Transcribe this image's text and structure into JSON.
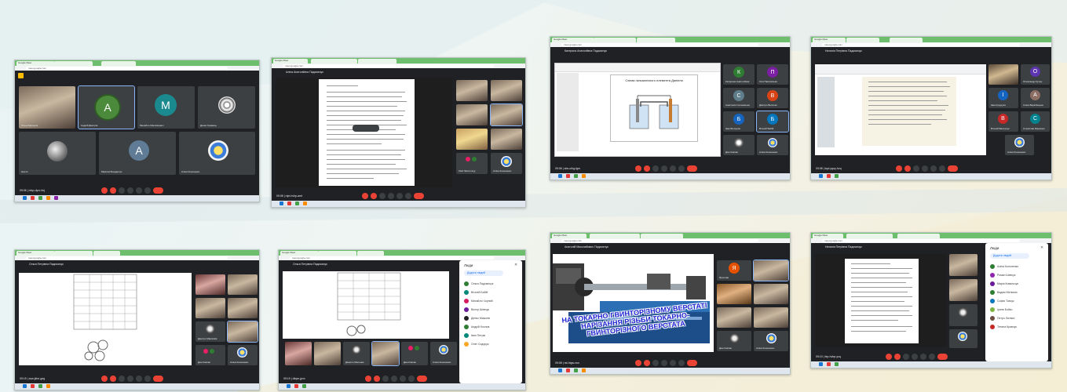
{
  "panels": {
    "p1": {
      "tab1": "Google Meet",
      "url": "meet.google.com",
      "meeting_code": "mhp-dyvr-hkj",
      "time": "09:06",
      "tiles": [
        {
          "initial": "",
          "color": "#5f6368",
          "name": "Ольга Мельник"
        },
        {
          "initial": "A",
          "color": "#4a8a3a",
          "name": "Андрій Дмитрів"
        },
        {
          "initial": "M",
          "color": "#1a8a8f",
          "name": "Михайло Максимович"
        },
        {
          "initial": "",
          "color": "#3c4043",
          "name": "Денис Кравець"
        },
        {
          "initial": "",
          "color": "#3c4043",
          "name": "Настя"
        },
        {
          "initial": "A",
          "color": "#5f7b96",
          "name": "Максим Бондарчук"
        },
        {
          "initial": "",
          "color": "#3c4043",
          "name": "Аліна Кононенко"
        }
      ]
    },
    "p2": {
      "tab1": "Google Meet",
      "url": "meet.google.com",
      "presenter": "Аліна Анатоліївна Падсмичук",
      "time": "09:08",
      "meeting_code": "mje-hvhp-amt",
      "side_names": [
        "",
        "",
        "",
        "",
        "",
        "",
        "Oleh Skoromnyj",
        "Аліна Кононенко"
      ]
    },
    "p3": {
      "tab1": "Google Meet",
      "url": "meet.google.com",
      "presenter": "Катерина Анатоліївна Падсмичук",
      "slide_title": "Схема гальванічного елемента Даніеля",
      "time": "09:06",
      "meeting_code": "abv-ufxg-fgm",
      "tiles": [
        {
          "initial": "К",
          "color": "#2e7d32",
          "name": "Катерина Анатоліївна"
        },
        {
          "initial": "П",
          "color": "#7b1fa2",
          "name": "Оля Павловська"
        },
        {
          "initial": "С",
          "color": "#607d8b",
          "name": "Анастасія Сосновська"
        },
        {
          "initial": "В",
          "color": "#d84315",
          "name": "Дмитро Величко"
        },
        {
          "initial": "Б",
          "color": "#1565c0",
          "name": "Іван Білоусов"
        },
        {
          "initial": "Б",
          "color": "#0277bd",
          "name": "Віталій Бабій"
        },
        {
          "initial": "",
          "color": "#3c4043",
          "name": "Дан Ковпак"
        },
        {
          "initial": "",
          "color": "#3c4043",
          "name": "Аліна Кононенко"
        }
      ]
    },
    "p4": {
      "tab1": "Google Meet",
      "url": "meet.google.com",
      "presenter": "Наталія Петрівна Падсмичук",
      "time": "09:08",
      "meeting_code": "kqd-yqoy-hzq",
      "tiles": [
        {
          "initial": "",
          "color": "#3c4043",
          "name": "Наталія"
        },
        {
          "initial": "О",
          "color": "#5e35b1",
          "name": "Олександр Кучер"
        },
        {
          "initial": "І",
          "color": "#1565c0",
          "name": "Іван Кукуруза"
        },
        {
          "initial": "А",
          "color": "#8d6e63",
          "name": "Аліна Вержбицька"
        },
        {
          "initial": "В",
          "color": "#c62828",
          "name": "Віталій Валерчук"
        },
        {
          "initial": "С",
          "color": "#00838f",
          "name": "Станіслав Марієнко"
        },
        {
          "initial": "",
          "color": "#3c4043",
          "name": "Аліна Кононенко"
        }
      ]
    },
    "p5": {
      "tab1": "Google Meet",
      "url": "meet.google.com",
      "presenter": "Ольга Петрівна Падсмичук",
      "time": "09:15",
      "meeting_code": "xsw-jkhn-geg",
      "side_names": [
        "",
        "",
        "",
        "",
        "Дмитро Максимів",
        "",
        "Дан Ковпак",
        "Аліна Кононенко"
      ]
    },
    "p6": {
      "tab1": "Google Meet",
      "url": "meet.google.com",
      "presenter": "Ольга Петрівна Падсмичук",
      "time": "09:19",
      "meeting_code": "dkqm-jpvx",
      "people_title": "Люди",
      "add_people": "Додати людей",
      "people": [
        {
          "name": "Ольга Падсмичук",
          "color": "#2e7d32"
        },
        {
          "name": "Віталій Бабій",
          "color": "#00897b"
        },
        {
          "name": "Михайло Чорний",
          "color": "#d81b60"
        },
        {
          "name": "Віктор Шевчук",
          "color": "#6a1b9a"
        },
        {
          "name": "Денис Миколів",
          "color": "#212121"
        },
        {
          "name": "Андрій Козлов",
          "color": "#2e7d32"
        },
        {
          "name": "Іван Петрів",
          "color": "#00897b"
        },
        {
          "name": "Олег Сидорук",
          "color": "#f9a825"
        }
      ],
      "bottom_names": [
        "",
        "",
        "Данило Мельник",
        "",
        "Дан Ковпак",
        "Аліна Кононенко"
      ]
    },
    "p7": {
      "tab1": "Google Meet",
      "url": "meet.google.com",
      "presenter": "Анатолій Миколайович Падсмичук",
      "slide_title": "НА ТОКАРНО-ГВИНТОРІЗНОМУ ВЕРСТАТІ НАРІЗАННЯ РІЗЬБИ ТОКАРНО-ГВИНТОРІЗНОГО ВЕРСТАТА",
      "time": "09:08",
      "meeting_code": "rst-htgw-rwn",
      "tiles": [
        {
          "initial": "Я",
          "color": "#e65100",
          "name": "Ярослав"
        },
        {
          "initial": "",
          "color": "#3c4043",
          "name": "Анатолій"
        },
        {
          "initial": "",
          "color": "#3c4043",
          "name": "Вадим"
        },
        {
          "initial": "",
          "color": "#3c4043",
          "name": "Богдан"
        },
        {
          "initial": "",
          "color": "#3c4043",
          "name": "Максим"
        },
        {
          "initial": "",
          "color": "#3c4043",
          "name": "Артем"
        },
        {
          "initial": "",
          "color": "#3c4043",
          "name": "Дан Ковпак"
        },
        {
          "initial": "",
          "color": "#3c4043",
          "name": "Аліна Кононенко"
        }
      ]
    },
    "p8": {
      "tab1": "Google Meet",
      "url": "meet.google.com",
      "presenter": "Наталія Петрівна Падсмичук",
      "time": "09:10",
      "meeting_code": "fep-hvbp-yxq",
      "people_title": "Люди",
      "add_people": "Додати людей",
      "people": [
        {
          "name": "Аліна Кононенко",
          "color": "#2e7d32"
        },
        {
          "name": "Роман Шевчук",
          "color": "#8e24aa"
        },
        {
          "name": "Марія Ковальчук",
          "color": "#6a1b9a"
        },
        {
          "name": "Вадим Мельник",
          "color": "#2e7d32"
        },
        {
          "name": "Софія Ткачук",
          "color": "#0277bd"
        },
        {
          "name": "Ірина Бойко",
          "color": "#7cb342"
        },
        {
          "name": "Петро Литвин",
          "color": "#6d4c41"
        },
        {
          "name": "Тетяна Кравчук",
          "color": "#c62828"
        }
      ]
    }
  }
}
